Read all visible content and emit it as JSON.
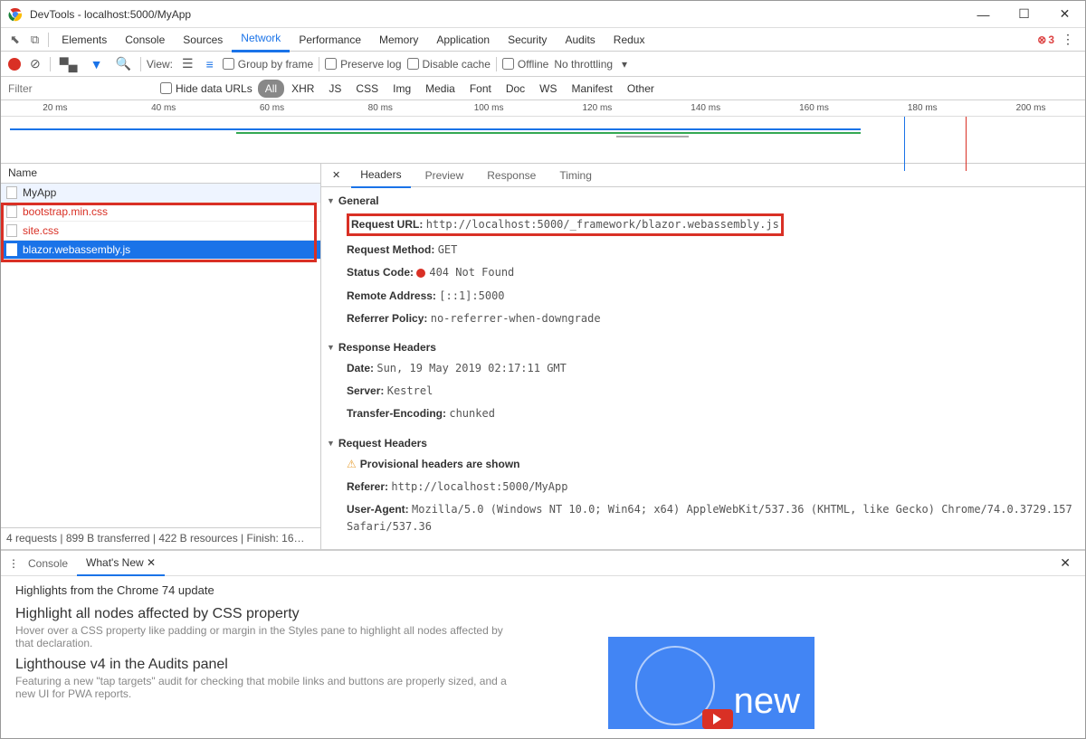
{
  "window": {
    "title": "DevTools - localhost:5000/MyApp"
  },
  "tabs": [
    "Elements",
    "Console",
    "Sources",
    "Network",
    "Performance",
    "Memory",
    "Application",
    "Security",
    "Audits",
    "Redux"
  ],
  "tabs_active": "Network",
  "errors": "3",
  "toolbar": {
    "view": "View:",
    "group_by_frame": "Group by frame",
    "preserve_log": "Preserve log",
    "disable_cache": "Disable cache",
    "offline": "Offline",
    "throttling": "No throttling"
  },
  "filterbar": {
    "placeholder": "Filter",
    "hide_data_urls": "Hide data URLs",
    "types": [
      "All",
      "XHR",
      "JS",
      "CSS",
      "Img",
      "Media",
      "Font",
      "Doc",
      "WS",
      "Manifest",
      "Other"
    ]
  },
  "ruler": [
    "20 ms",
    "40 ms",
    "60 ms",
    "80 ms",
    "100 ms",
    "120 ms",
    "140 ms",
    "160 ms",
    "180 ms",
    "200 ms"
  ],
  "requests": {
    "header": "Name",
    "items": [
      {
        "name": "MyApp",
        "error": false,
        "selected": false
      },
      {
        "name": "bootstrap.min.css",
        "error": true,
        "selected": false
      },
      {
        "name": "site.css",
        "error": true,
        "selected": false
      },
      {
        "name": "blazor.webassembly.js",
        "error": false,
        "selected": true
      }
    ],
    "status": "4 requests  |  899 B transferred  |  422 B resources  |  Finish: 16…"
  },
  "detail_tabs": [
    "Headers",
    "Preview",
    "Response",
    "Timing"
  ],
  "detail_active": "Headers",
  "headers": {
    "general_label": "General",
    "request_url_k": "Request URL:",
    "request_url_v": "http://localhost:5000/_framework/blazor.webassembly.js",
    "method_k": "Request Method:",
    "method_v": "GET",
    "status_k": "Status Code:",
    "status_v": "404 Not Found",
    "remote_k": "Remote Address:",
    "remote_v": "[::1]:5000",
    "refpol_k": "Referrer Policy:",
    "refpol_v": "no-referrer-when-downgrade",
    "response_label": "Response Headers",
    "date_k": "Date:",
    "date_v": "Sun, 19 May 2019 02:17:11 GMT",
    "server_k": "Server:",
    "server_v": "Kestrel",
    "te_k": "Transfer-Encoding:",
    "te_v": "chunked",
    "request_label": "Request Headers",
    "provisional": "Provisional headers are shown",
    "referer_k": "Referer:",
    "referer_v": "http://localhost:5000/MyApp",
    "ua_k": "User-Agent:",
    "ua_v": "Mozilla/5.0 (Windows NT 10.0; Win64; x64) AppleWebKit/537.36 (KHTML, like Gecko) Chrome/74.0.3729.157 Safari/537.36"
  },
  "drawer": {
    "tabs": [
      "Console",
      "What's New"
    ],
    "active": "What's New",
    "headline": "Highlights from the Chrome 74 update",
    "items": [
      {
        "title": "Highlight all nodes affected by CSS property",
        "sub": "Hover over a CSS property like padding or margin in the Styles pane to highlight all nodes affected by that declaration."
      },
      {
        "title": "Lighthouse v4 in the Audits panel",
        "sub": "Featuring a new \"tap targets\" audit for checking that mobile links and buttons are properly sized, and a new UI for PWA reports."
      }
    ],
    "thumb_text": "new"
  }
}
